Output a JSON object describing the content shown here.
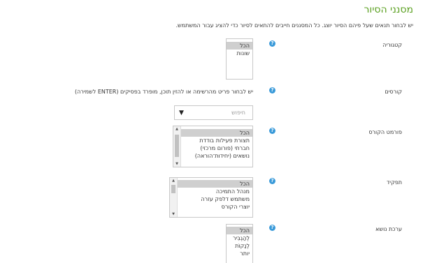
{
  "title": "מסנני הסיור",
  "description": "יש לבחור תנאים שעל פיהם הסיור יוצג. כל המסננים חייבים להתאים לסיור כדי להציג עבור המשתמש.",
  "help_glyph": "?",
  "fields": {
    "category": {
      "label": "קטגוריה",
      "options": [
        "הכל",
        "שונות"
      ]
    },
    "courses": {
      "label": "קורסים",
      "note": "יש לבחור פריט מהרשימה או להזין תוכן, מופרד בפסיקים (ENTER לשמירה)",
      "search_placeholder": "חיפוש",
      "arrow": "▼"
    },
    "course_format": {
      "label": "פורמט הקורס",
      "options": [
        "הכל",
        "תצורת פעילות בודדת",
        "חברתי (פורום מרכזי)",
        "נושאים (יחידות־הוראה)"
      ]
    },
    "role": {
      "label": "תפקיד",
      "options": [
        "הכל",
        "מנהל התמיכה",
        "משתמש דלפק עזרה",
        "יוצרי הקורס"
      ]
    },
    "theme": {
      "label": "ערכת נושא",
      "options": [
        "הכל",
        "לְהַגְבִּיר",
        "לְנַקוֹת",
        "יותר"
      ]
    }
  },
  "scroll_arrows": {
    "up": "▲",
    "down": "▼"
  }
}
